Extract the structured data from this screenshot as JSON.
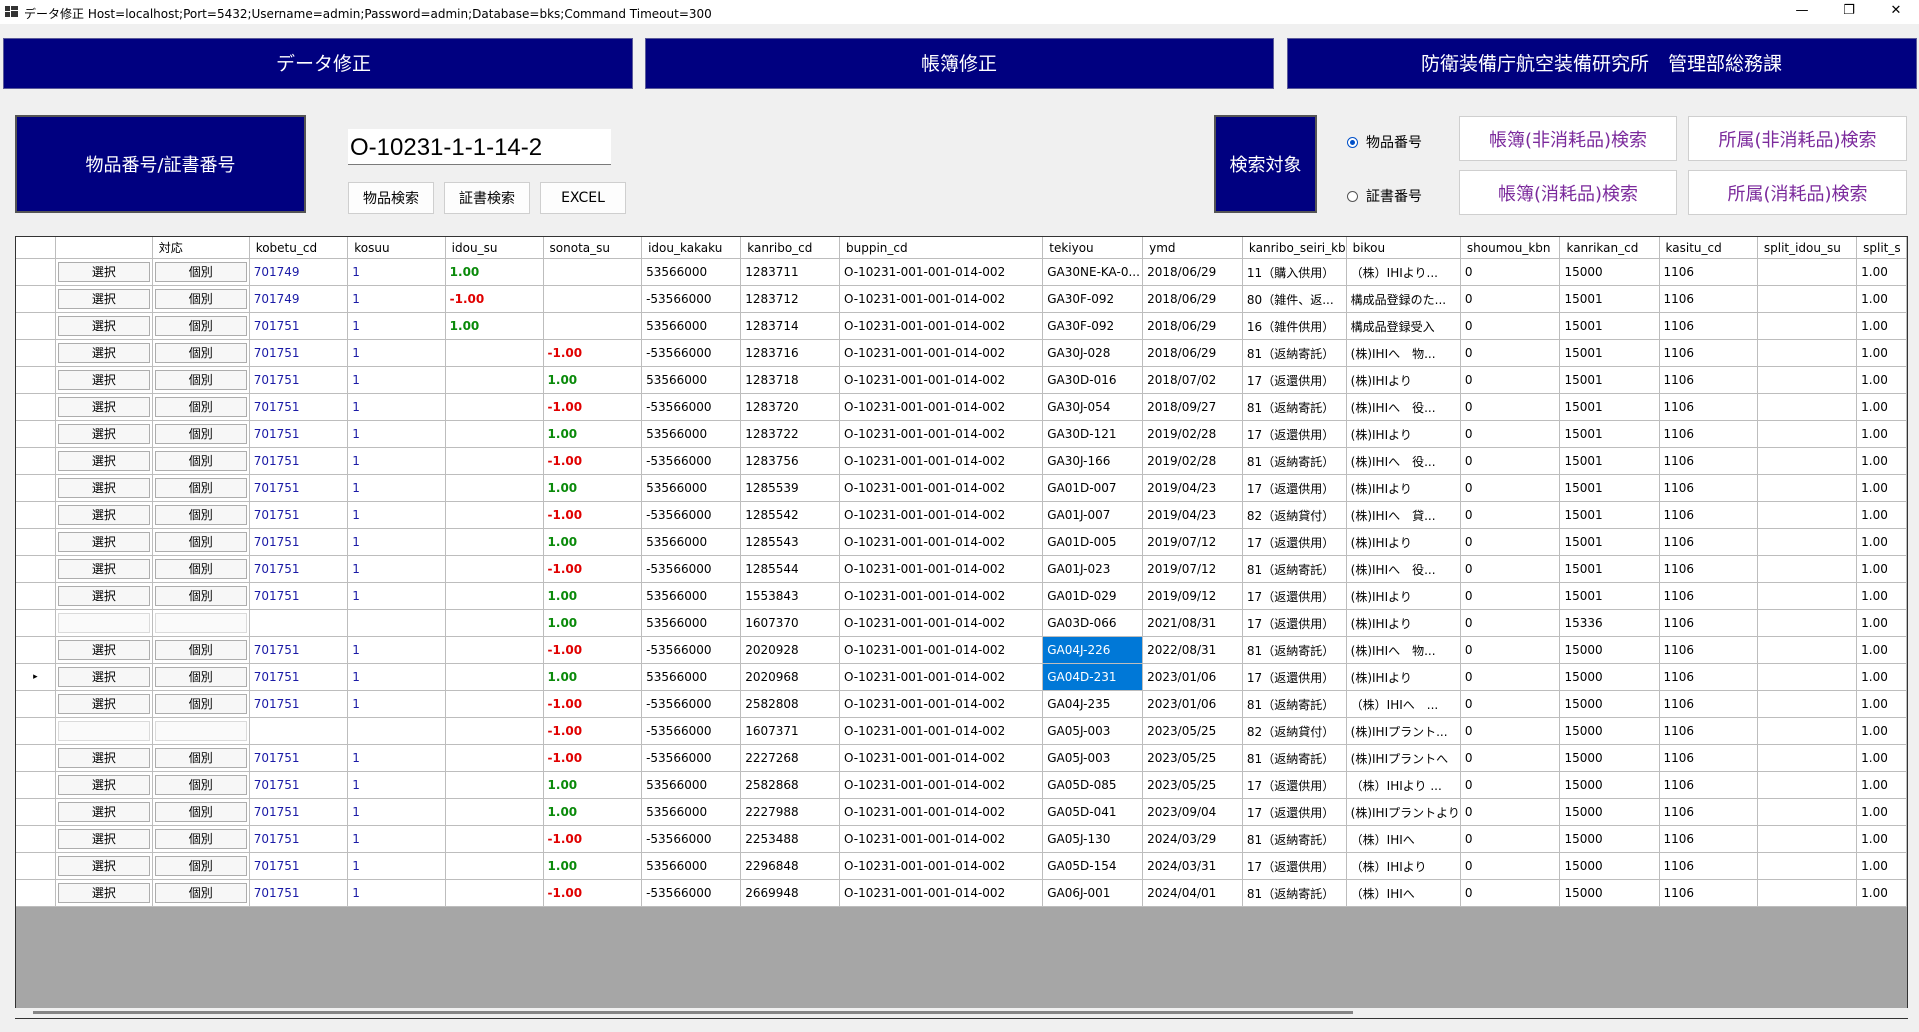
{
  "window": {
    "title": "データ修正 Host=localhost;Port=5432;Username=admin;Password=admin;Database=bks;Command Timeout=300",
    "min": "—",
    "max": "❐",
    "close": "✕"
  },
  "banners": {
    "data_fix": "データ修正",
    "ledger_fix": "帳簿修正",
    "org": "防衛装備庁航空装備研究所　管理部総務課"
  },
  "search": {
    "label": "物品番号/証書番号",
    "value": "O-10231-1-1-14-2",
    "item_search": "物品検索",
    "cert_search": "証書検索",
    "excel": "EXCEL",
    "target_label": "検索対象",
    "radio_item": "物品番号",
    "radio_cert": "証書番号",
    "selected": "物品番号",
    "btn_ledger_nonconsumable": "帳簿(非消耗品)検索",
    "btn_dept_nonconsumable": "所属(非消耗品)検索",
    "btn_ledger_consumable": "帳簿(消耗品)検索",
    "btn_dept_consumable": "所属(消耗品)検索"
  },
  "grid": {
    "columns": [
      "",
      "対応",
      "kobetu_cd",
      "kosuu",
      "idou_su",
      "sonota_su",
      "idou_kakaku",
      "kanribo_cd",
      "buppin_cd",
      "tekiyou",
      "ymd",
      "kanribo_seiri_kb",
      "bikou",
      "shoumou_kbn",
      "kanrikan_cd",
      "kasitu_cd",
      "split_idou_su",
      "split_s"
    ],
    "current_row_marker": "▸",
    "rows": [
      {
        "btn1": "選択",
        "btn2": "個別",
        "kobetu_cd": "701749",
        "kosuu": "1",
        "idou_su": "1.00",
        "sonota_su": "",
        "idou_kakaku": "53566000",
        "kanribo_cd": "1283711",
        "buppin_cd": "O-10231-001-001-014-002",
        "tekiyou": "GA30NE-KA-0...",
        "ymd": "2018/06/29",
        "seiri": "11（購入供用）",
        "bikou": "（株）IHIより...",
        "shoumou": "0",
        "kanrikan": "15000",
        "kasitu": "1106",
        "split": "1.00"
      },
      {
        "btn1": "選択",
        "btn2": "個別",
        "kobetu_cd": "701749",
        "kosuu": "1",
        "idou_su": "-1.00",
        "sonota_su": "",
        "idou_kakaku": "-53566000",
        "kanribo_cd": "1283712",
        "buppin_cd": "O-10231-001-001-014-002",
        "tekiyou": "GA30F-092",
        "ymd": "2018/06/29",
        "seiri": "80（雑件、返...",
        "bikou": "構成品登録のた...",
        "shoumou": "0",
        "kanrikan": "15001",
        "kasitu": "1106",
        "split": "1.00"
      },
      {
        "btn1": "選択",
        "btn2": "個別",
        "kobetu_cd": "701751",
        "kosuu": "1",
        "idou_su": "1.00",
        "sonota_su": "",
        "idou_kakaku": "53566000",
        "kanribo_cd": "1283714",
        "buppin_cd": "O-10231-001-001-014-002",
        "tekiyou": "GA30F-092",
        "ymd": "2018/06/29",
        "seiri": "16（雑件供用）",
        "bikou": "構成品登録受入",
        "shoumou": "0",
        "kanrikan": "15001",
        "kasitu": "1106",
        "split": "1.00"
      },
      {
        "btn1": "選択",
        "btn2": "個別",
        "kobetu_cd": "701751",
        "kosuu": "1",
        "idou_su": "",
        "sonota_su": "-1.00",
        "idou_kakaku": "-53566000",
        "kanribo_cd": "1283716",
        "buppin_cd": "O-10231-001-001-014-002",
        "tekiyou": "GA30J-028",
        "ymd": "2018/06/29",
        "seiri": "81（返納寄託）",
        "bikou": "(株)IHIへ　物...",
        "shoumou": "0",
        "kanrikan": "15001",
        "kasitu": "1106",
        "split": "1.00"
      },
      {
        "btn1": "選択",
        "btn2": "個別",
        "kobetu_cd": "701751",
        "kosuu": "1",
        "idou_su": "",
        "sonota_su": "1.00",
        "idou_kakaku": "53566000",
        "kanribo_cd": "1283718",
        "buppin_cd": "O-10231-001-001-014-002",
        "tekiyou": "GA30D-016",
        "ymd": "2018/07/02",
        "seiri": "17（返還供用）",
        "bikou": "(株)IHIより",
        "shoumou": "0",
        "kanrikan": "15001",
        "kasitu": "1106",
        "split": "1.00"
      },
      {
        "btn1": "選択",
        "btn2": "個別",
        "kobetu_cd": "701751",
        "kosuu": "1",
        "idou_su": "",
        "sonota_su": "-1.00",
        "idou_kakaku": "-53566000",
        "kanribo_cd": "1283720",
        "buppin_cd": "O-10231-001-001-014-002",
        "tekiyou": "GA30J-054",
        "ymd": "2018/09/27",
        "seiri": "81（返納寄託）",
        "bikou": "(株)IHIへ　役...",
        "shoumou": "0",
        "kanrikan": "15001",
        "kasitu": "1106",
        "split": "1.00"
      },
      {
        "btn1": "選択",
        "btn2": "個別",
        "kobetu_cd": "701751",
        "kosuu": "1",
        "idou_su": "",
        "sonota_su": "1.00",
        "idou_kakaku": "53566000",
        "kanribo_cd": "1283722",
        "buppin_cd": "O-10231-001-001-014-002",
        "tekiyou": "GA30D-121",
        "ymd": "2019/02/28",
        "seiri": "17（返還供用）",
        "bikou": "(株)IHIより",
        "shoumou": "0",
        "kanrikan": "15001",
        "kasitu": "1106",
        "split": "1.00"
      },
      {
        "btn1": "選択",
        "btn2": "個別",
        "kobetu_cd": "701751",
        "kosuu": "1",
        "idou_su": "",
        "sonota_su": "-1.00",
        "idou_kakaku": "-53566000",
        "kanribo_cd": "1283756",
        "buppin_cd": "O-10231-001-001-014-002",
        "tekiyou": "GA30J-166",
        "ymd": "2019/02/28",
        "seiri": "81（返納寄託）",
        "bikou": "(株)IHIへ　役...",
        "shoumou": "0",
        "kanrikan": "15001",
        "kasitu": "1106",
        "split": "1.00"
      },
      {
        "btn1": "選択",
        "btn2": "個別",
        "kobetu_cd": "701751",
        "kosuu": "1",
        "idou_su": "",
        "sonota_su": "1.00",
        "idou_kakaku": "53566000",
        "kanribo_cd": "1285539",
        "buppin_cd": "O-10231-001-001-014-002",
        "tekiyou": "GA01D-007",
        "ymd": "2019/04/23",
        "seiri": "17（返還供用）",
        "bikou": "(株)IHIより",
        "shoumou": "0",
        "kanrikan": "15001",
        "kasitu": "1106",
        "split": "1.00"
      },
      {
        "btn1": "選択",
        "btn2": "個別",
        "kobetu_cd": "701751",
        "kosuu": "1",
        "idou_su": "",
        "sonota_su": "-1.00",
        "idou_kakaku": "-53566000",
        "kanribo_cd": "1285542",
        "buppin_cd": "O-10231-001-001-014-002",
        "tekiyou": "GA01J-007",
        "ymd": "2019/04/23",
        "seiri": "82（返納貸付）",
        "bikou": "(株)IHIへ　貸...",
        "shoumou": "0",
        "kanrikan": "15001",
        "kasitu": "1106",
        "split": "1.00"
      },
      {
        "btn1": "選択",
        "btn2": "個別",
        "kobetu_cd": "701751",
        "kosuu": "1",
        "idou_su": "",
        "sonota_su": "1.00",
        "idou_kakaku": "53566000",
        "kanribo_cd": "1285543",
        "buppin_cd": "O-10231-001-001-014-002",
        "tekiyou": "GA01D-005",
        "ymd": "2019/07/12",
        "seiri": "17（返還供用）",
        "bikou": "(株)IHIより",
        "shoumou": "0",
        "kanrikan": "15001",
        "kasitu": "1106",
        "split": "1.00"
      },
      {
        "btn1": "選択",
        "btn2": "個別",
        "kobetu_cd": "701751",
        "kosuu": "1",
        "idou_su": "",
        "sonota_su": "-1.00",
        "idou_kakaku": "-53566000",
        "kanribo_cd": "1285544",
        "buppin_cd": "O-10231-001-001-014-002",
        "tekiyou": "GA01J-023",
        "ymd": "2019/07/12",
        "seiri": "81（返納寄託）",
        "bikou": "(株)IHIへ　役...",
        "shoumou": "0",
        "kanrikan": "15001",
        "kasitu": "1106",
        "split": "1.00"
      },
      {
        "btn1": "選択",
        "btn2": "個別",
        "kobetu_cd": "701751",
        "kosuu": "1",
        "idou_su": "",
        "sonota_su": "1.00",
        "idou_kakaku": "53566000",
        "kanribo_cd": "1553843",
        "buppin_cd": "O-10231-001-001-014-002",
        "tekiyou": "GA01D-029",
        "ymd": "2019/09/12",
        "seiri": "17（返還供用）",
        "bikou": "(株)IHIより",
        "shoumou": "0",
        "kanrikan": "15001",
        "kasitu": "1106",
        "split": "1.00"
      },
      {
        "btn1": "",
        "btn2": "",
        "kobetu_cd": "",
        "kosuu": "",
        "idou_su": "",
        "sonota_su": "1.00",
        "idou_kakaku": "53566000",
        "kanribo_cd": "1607370",
        "buppin_cd": "O-10231-001-001-014-002",
        "tekiyou": "GA03D-066",
        "ymd": "2021/08/31",
        "seiri": "17（返還供用）",
        "bikou": "(株)IHIより",
        "shoumou": "0",
        "kanrikan": "15336",
        "kasitu": "1106",
        "split": "1.00"
      },
      {
        "btn1": "選択",
        "btn2": "個別",
        "kobetu_cd": "701751",
        "kosuu": "1",
        "idou_su": "",
        "sonota_su": "-1.00",
        "idou_kakaku": "-53566000",
        "kanribo_cd": "2020928",
        "buppin_cd": "O-10231-001-001-014-002",
        "tekiyou": "GA04J-226",
        "ymd": "2022/08/31",
        "seiri": "81（返納寄託）",
        "bikou": "(株)IHIへ　物...",
        "shoumou": "0",
        "kanrikan": "15000",
        "kasitu": "1106",
        "split": "1.00"
      },
      {
        "btn1": "選択",
        "btn2": "個別",
        "kobetu_cd": "701751",
        "kosuu": "1",
        "idou_su": "",
        "sonota_su": "1.00",
        "idou_kakaku": "53566000",
        "kanribo_cd": "2020968",
        "buppin_cd": "O-10231-001-001-014-002",
        "tekiyou": "GA04D-231",
        "ymd": "2023/01/06",
        "seiri": "17（返還供用）",
        "bikou": "(株)IHIより",
        "shoumou": "0",
        "kanrikan": "15000",
        "kasitu": "1106",
        "split": "1.00"
      },
      {
        "btn1": "選択",
        "btn2": "個別",
        "kobetu_cd": "701751",
        "kosuu": "1",
        "idou_su": "",
        "sonota_su": "-1.00",
        "idou_kakaku": "-53566000",
        "kanribo_cd": "2582808",
        "buppin_cd": "O-10231-001-001-014-002",
        "tekiyou": "GA04J-235",
        "ymd": "2023/01/06",
        "seiri": "81（返納寄託）",
        "bikou": "（株）IHIへ　...",
        "shoumou": "0",
        "kanrikan": "15000",
        "kasitu": "1106",
        "split": "1.00"
      },
      {
        "btn1": "",
        "btn2": "",
        "kobetu_cd": "",
        "kosuu": "",
        "idou_su": "",
        "sonota_su": "-1.00",
        "idou_kakaku": "-53566000",
        "kanribo_cd": "1607371",
        "buppin_cd": "O-10231-001-001-014-002",
        "tekiyou": "GA05J-003",
        "ymd": "2023/05/25",
        "seiri": "82（返納貸付）",
        "bikou": "(株)IHIプラント...",
        "shoumou": "0",
        "kanrikan": "15000",
        "kasitu": "1106",
        "split": "1.00"
      },
      {
        "btn1": "選択",
        "btn2": "個別",
        "kobetu_cd": "701751",
        "kosuu": "1",
        "idou_su": "",
        "sonota_su": "-1.00",
        "idou_kakaku": "-53566000",
        "kanribo_cd": "2227268",
        "buppin_cd": "O-10231-001-001-014-002",
        "tekiyou": "GA05J-003",
        "ymd": "2023/05/25",
        "seiri": "81（返納寄託）",
        "bikou": "(株)IHIプラントへ",
        "shoumou": "0",
        "kanrikan": "15000",
        "kasitu": "1106",
        "split": "1.00"
      },
      {
        "btn1": "選択",
        "btn2": "個別",
        "kobetu_cd": "701751",
        "kosuu": "1",
        "idou_su": "",
        "sonota_su": "1.00",
        "idou_kakaku": "53566000",
        "kanribo_cd": "2582868",
        "buppin_cd": "O-10231-001-001-014-002",
        "tekiyou": "GA05D-085",
        "ymd": "2023/05/25",
        "seiri": "17（返還供用）",
        "bikou": "（株）IHIより ...",
        "shoumou": "0",
        "kanrikan": "15000",
        "kasitu": "1106",
        "split": "1.00"
      },
      {
        "btn1": "選択",
        "btn2": "個別",
        "kobetu_cd": "701751",
        "kosuu": "1",
        "idou_su": "",
        "sonota_su": "1.00",
        "idou_kakaku": "53566000",
        "kanribo_cd": "2227988",
        "buppin_cd": "O-10231-001-001-014-002",
        "tekiyou": "GA05D-041",
        "ymd": "2023/09/04",
        "seiri": "17（返還供用）",
        "bikou": "(株)IHIプラントより",
        "shoumou": "0",
        "kanrikan": "15000",
        "kasitu": "1106",
        "split": "1.00"
      },
      {
        "btn1": "選択",
        "btn2": "個別",
        "kobetu_cd": "701751",
        "kosuu": "1",
        "idou_su": "",
        "sonota_su": "-1.00",
        "idou_kakaku": "-53566000",
        "kanribo_cd": "2253488",
        "buppin_cd": "O-10231-001-001-014-002",
        "tekiyou": "GA05J-130",
        "ymd": "2024/03/29",
        "seiri": "81（返納寄託）",
        "bikou": "（株）IHIへ",
        "shoumou": "0",
        "kanrikan": "15000",
        "kasitu": "1106",
        "split": "1.00"
      },
      {
        "btn1": "選択",
        "btn2": "個別",
        "kobetu_cd": "701751",
        "kosuu": "1",
        "idou_su": "",
        "sonota_su": "1.00",
        "idou_kakaku": "53566000",
        "kanribo_cd": "2296848",
        "buppin_cd": "O-10231-001-001-014-002",
        "tekiyou": "GA05D-154",
        "ymd": "2024/03/31",
        "seiri": "17（返還供用）",
        "bikou": "（株）IHIより",
        "shoumou": "0",
        "kanrikan": "15000",
        "kasitu": "1106",
        "split": "1.00"
      },
      {
        "btn1": "選択",
        "btn2": "個別",
        "kobetu_cd": "701751",
        "kosuu": "1",
        "idou_su": "",
        "sonota_su": "-1.00",
        "idou_kakaku": "-53566000",
        "kanribo_cd": "2669948",
        "buppin_cd": "O-10231-001-001-014-002",
        "tekiyou": "GA06J-001",
        "ymd": "2024/04/01",
        "seiri": "81（返納寄託）",
        "bikou": "（株）IHIへ",
        "shoumou": "0",
        "kanrikan": "15000",
        "kasitu": "1106",
        "split": "1.00"
      }
    ]
  },
  "colors": {
    "navy": "#000080",
    "select_highlight": "#0078d7",
    "positive": "#0a8a0a",
    "negative": "#e00000",
    "link_blue": "#1a1aa6",
    "accent_purple": "#7b2a9c"
  }
}
